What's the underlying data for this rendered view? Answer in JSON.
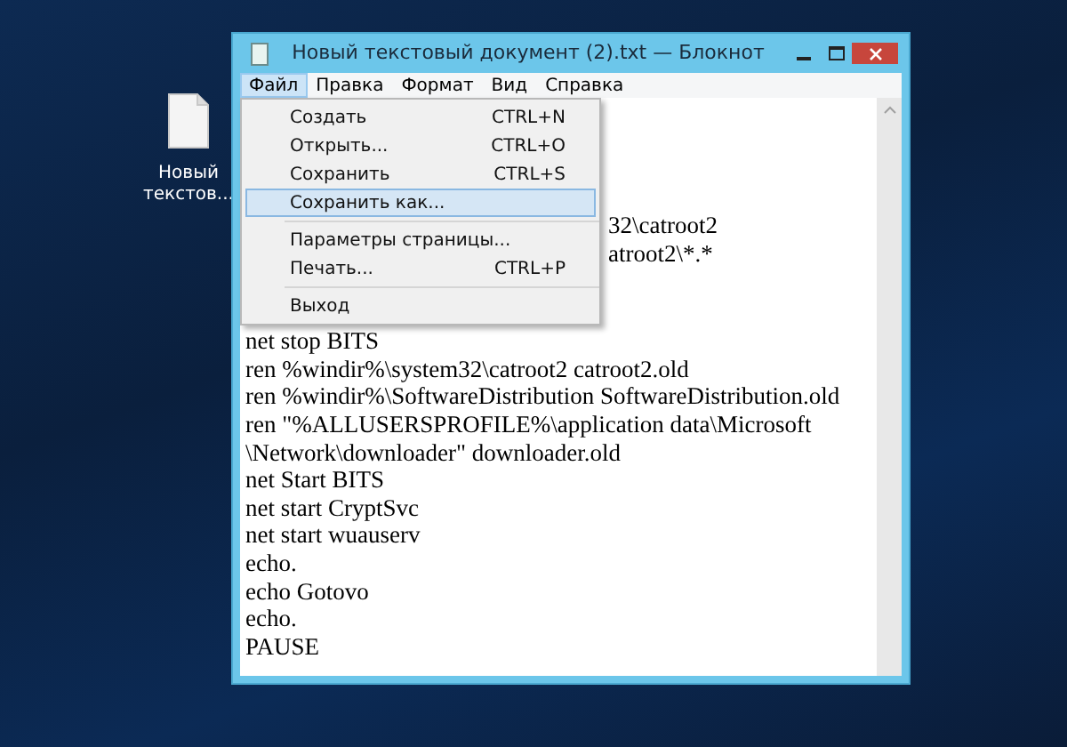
{
  "desktop_icon": {
    "label": "Новый текстов..."
  },
  "window": {
    "title": "Новый текстовый документ (2).txt — Блокнот"
  },
  "menu_bar": [
    {
      "label": "Файл",
      "selected": true
    },
    {
      "label": "Правка",
      "selected": false
    },
    {
      "label": "Формат",
      "selected": false
    },
    {
      "label": "Вид",
      "selected": false
    },
    {
      "label": "Справка",
      "selected": false
    }
  ],
  "file_menu": [
    {
      "kind": "item",
      "label": "Создать",
      "shortcut": "CTRL+N",
      "selected": false
    },
    {
      "kind": "item",
      "label": "Открыть...",
      "shortcut": "CTRL+O",
      "selected": false
    },
    {
      "kind": "item",
      "label": "Сохранить",
      "shortcut": "CTRL+S",
      "selected": false
    },
    {
      "kind": "item",
      "label": "Сохранить как...",
      "selected": true
    },
    {
      "kind": "separator"
    },
    {
      "kind": "item",
      "label": "Параметры страницы...",
      "selected": false
    },
    {
      "kind": "item",
      "label": "Печать...",
      "shortcut": "CTRL+P",
      "selected": false
    },
    {
      "kind": "separator"
    },
    {
      "kind": "item",
      "label": "Выход",
      "selected": false
    }
  ],
  "editor": {
    "lines_beside_menu": [
      "32\\catroot2",
      "atroot2\\*.*"
    ],
    "lines": [
      "net stop BITS",
      "ren %windir%\\system32\\catroot2 catroot2.old",
      "ren %windir%\\SoftwareDistribution SoftwareDistribution.old",
      "ren \"%ALLUSERSPROFILE%\\application data\\Microsoft",
      "\\Network\\downloader\" downloader.old",
      "net Start BITS",
      "net start CryptSvc",
      "net start wuauserv",
      "echo.",
      "echo Gotovo",
      "echo.",
      "PAUSE"
    ]
  }
}
